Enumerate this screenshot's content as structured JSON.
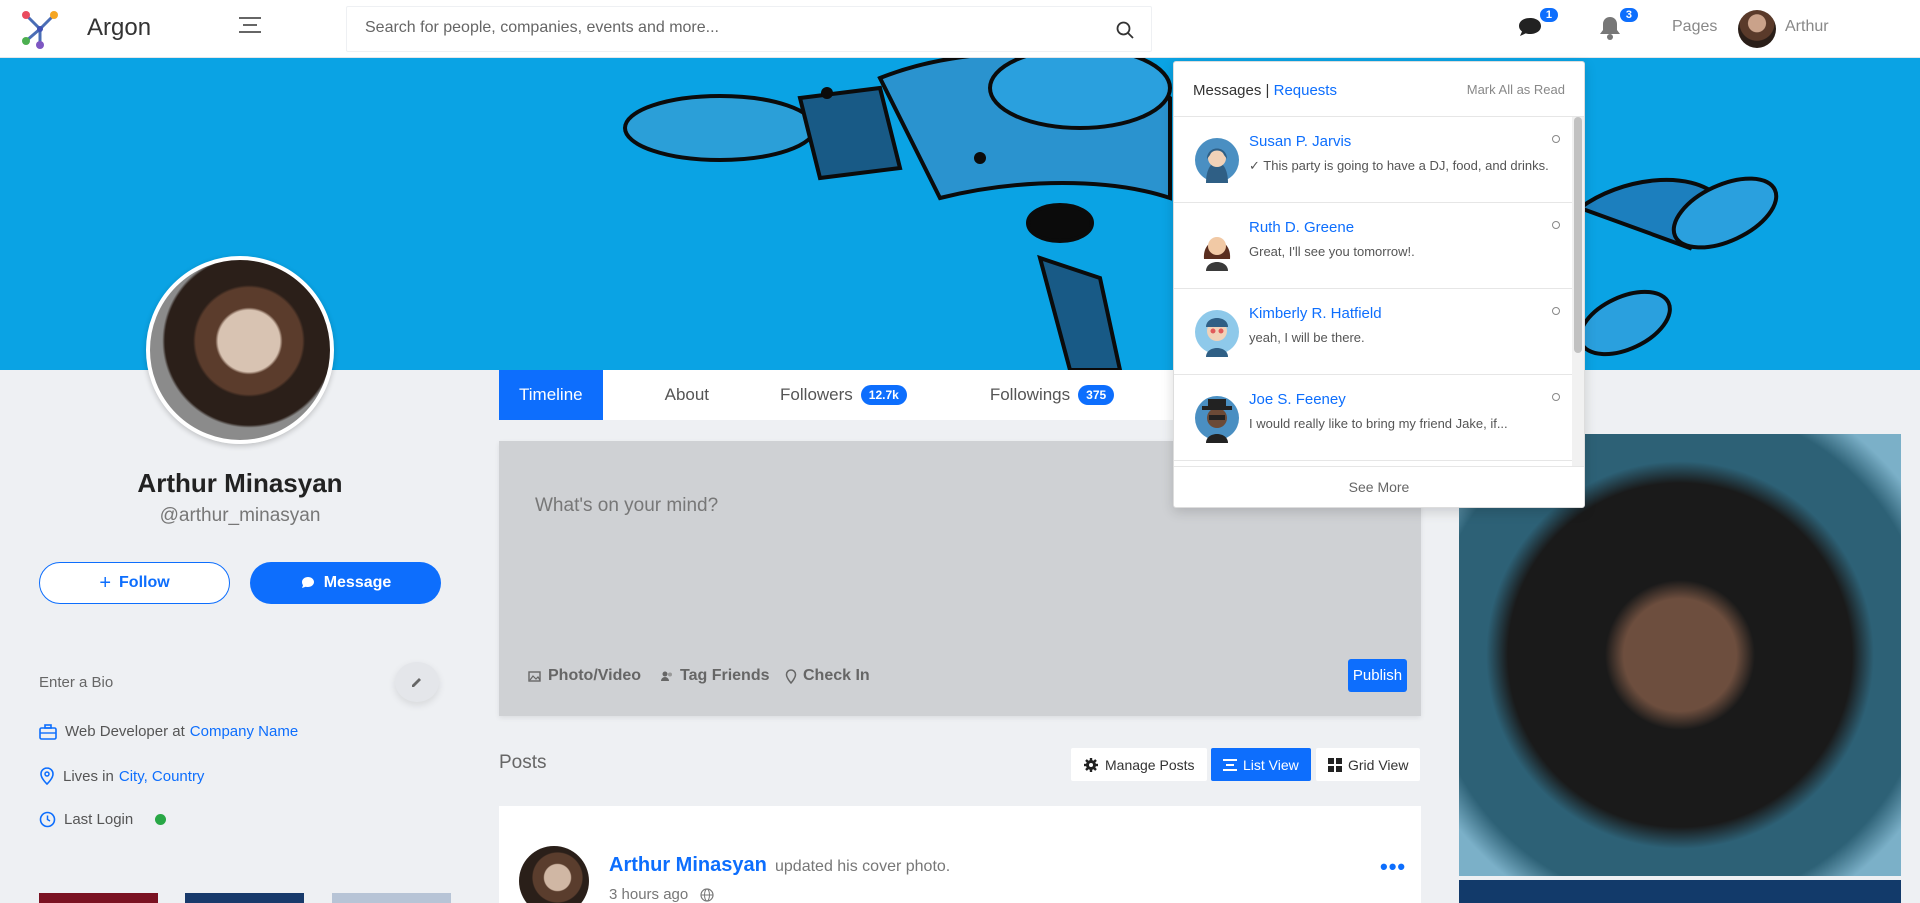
{
  "app": {
    "brand": "Argon"
  },
  "search": {
    "placeholder": "Search for people, companies, events and more..."
  },
  "nav": {
    "messages_badge": "1",
    "notifications_badge": "3",
    "pages": "Pages",
    "user_name": "Arthur"
  },
  "profile": {
    "name": "Arthur Minasyan",
    "handle": "@arthur_minasyan",
    "follow_label": "Follow",
    "message_label": "Message",
    "bio_placeholder": "Enter a Bio",
    "job_prefix": "Web Developer at",
    "job_company": "Company Name",
    "lives_prefix": "Lives in",
    "lives_location": "City, Country",
    "last_login": "Last Login"
  },
  "tabs": [
    {
      "label": "Timeline"
    },
    {
      "label": "About"
    },
    {
      "label": "Followers",
      "badge": "12.7k"
    },
    {
      "label": "Followings",
      "badge": "375"
    }
  ],
  "composer": {
    "placeholder": "What's on your mind?",
    "photo_video": "Photo/Video",
    "tag_friends": "Tag Friends",
    "check_in": "Check In",
    "publish": "Publish"
  },
  "posts": {
    "title": "Posts",
    "manage": "Manage Posts",
    "list_view": "List View",
    "grid_view": "Grid View"
  },
  "post": {
    "author": "Arthur Minasyan",
    "action": "updated his cover photo.",
    "time": "3 hours ago",
    "more": "•••"
  },
  "messages_dropdown": {
    "title": "Messages",
    "separator": " | ",
    "requests": "Requests",
    "mark_all": "Mark All as Read",
    "see_more": "See More",
    "items": [
      {
        "name": "Susan P. Jarvis",
        "text": "✓ This party is going to have a DJ, food, and drinks."
      },
      {
        "name": "Ruth D. Greene",
        "text": "Great, I'll see you tomorrow!."
      },
      {
        "name": "Kimberly R. Hatfield",
        "text": "yeah, I will be there."
      },
      {
        "name": "Joe S. Feeney",
        "text": "I would really like to bring my friend Jake, if..."
      }
    ]
  },
  "colors": {
    "primary": "#0d6efd",
    "cover": "#0aa3e4",
    "online": "#28a745"
  }
}
